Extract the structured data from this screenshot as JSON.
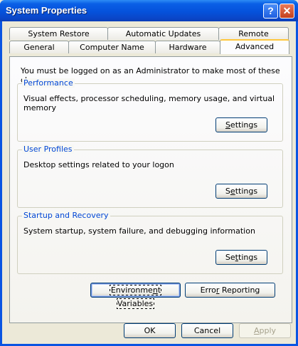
{
  "window": {
    "title": "System Properties",
    "help_glyph": "?",
    "close_glyph": "✕"
  },
  "tabs": {
    "row1": [
      "System Restore",
      "Automatic Updates",
      "Remote"
    ],
    "row2": [
      "General",
      "Computer Name",
      "Hardware",
      "Advanced"
    ],
    "active": "Advanced"
  },
  "advanced": {
    "intro": "You must be logged on as an Administrator to make most of these changes.",
    "performance": {
      "title": "Performance",
      "description": "Visual effects, processor scheduling, memory usage, and virtual memory",
      "button_pre": "",
      "button_u": "S",
      "button_post": "ettings"
    },
    "user_profiles": {
      "title": "User Profiles",
      "description": "Desktop settings related to your logon",
      "button_pre": "S",
      "button_u": "e",
      "button_post": "ttings"
    },
    "startup_recovery": {
      "title": "Startup and Recovery",
      "description": "System startup, system failure, and debugging information",
      "button_pre": "Se",
      "button_u": "t",
      "button_post": "tings"
    },
    "env_button": {
      "pre": "Environme",
      "u": "n",
      "post": "t Variables"
    },
    "error_button": {
      "pre": "Erro",
      "u": "r",
      "post": " Reporting"
    }
  },
  "footer": {
    "ok": "OK",
    "cancel": "Cancel",
    "apply_pre": "",
    "apply_u": "A",
    "apply_post": "pply"
  }
}
